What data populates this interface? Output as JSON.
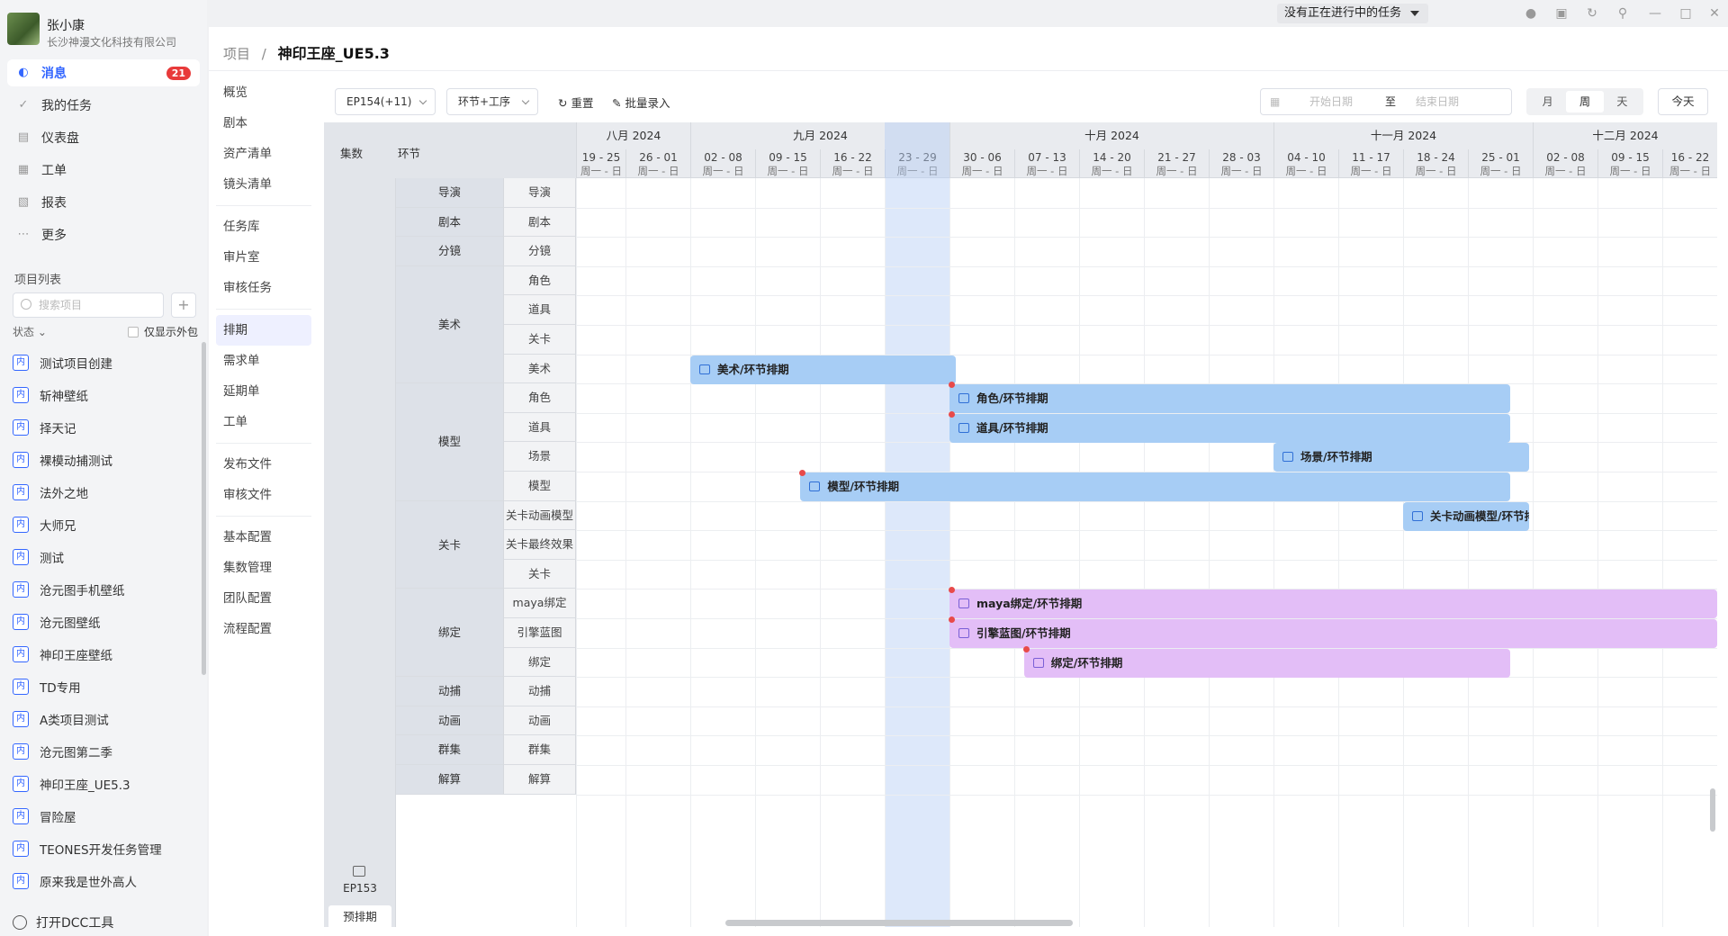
{
  "user": {
    "name": "张小康",
    "company": "长沙神漫文化科技有限公司"
  },
  "nav": [
    {
      "label": "消息",
      "icon": "message-icon",
      "badge": "21"
    },
    {
      "label": "我的任务",
      "icon": "check-icon"
    },
    {
      "label": "仪表盘",
      "icon": "dashboard-icon"
    },
    {
      "label": "工单",
      "icon": "workorder-icon"
    },
    {
      "label": "报表",
      "icon": "report-icon"
    },
    {
      "label": "更多",
      "icon": "more-icon"
    }
  ],
  "projects": {
    "heading": "项目列表",
    "search_placeholder": "搜索项目",
    "add": "+",
    "status_filter": "状态",
    "external_only": "仅显示外包",
    "tag": "内",
    "items": [
      "测试项目创建",
      "斩神壁纸",
      "择天记",
      "裸模动捕测试",
      "法外之地",
      "大师兄",
      "测试",
      "沧元图手机壁纸",
      "沧元图壁纸",
      "神印王座壁纸",
      "TD专用",
      "A类项目测试",
      "沧元图第二季",
      "神印王座_UE5.3",
      "冒险屋",
      "TEONES开发任务管理",
      "原来我是世外高人"
    ],
    "dcc": "打开DCC工具"
  },
  "titlebar": {
    "task_status": "没有正在进行中的任务"
  },
  "breadcrumb": {
    "root": "项目",
    "sep": "/",
    "current": "神印王座_UE5.3"
  },
  "subnav": {
    "groups": [
      [
        "概览",
        "剧本",
        "资产清单",
        "镜头清单"
      ],
      [
        "任务库",
        "审片室",
        "审核任务"
      ],
      [
        "排期",
        "需求单",
        "延期单",
        "工单"
      ],
      [
        "发布文件",
        "审核文件"
      ],
      [
        "基本配置",
        "集数管理",
        "团队配置",
        "流程配置"
      ]
    ],
    "active": "排期"
  },
  "toolbar": {
    "episode": "EP154(+11)",
    "mode": "环节+工序",
    "reset": "重置",
    "batch": "批量录入",
    "start_placeholder": "开始日期",
    "to": "至",
    "end_placeholder": "结束日期",
    "views": [
      "月",
      "周",
      "天"
    ],
    "active_view": "周",
    "today": "今天"
  },
  "schedule": {
    "head_episode": "集数",
    "head_stage": "环节",
    "episode": "EP153",
    "pre_btn": "预排期",
    "months": [
      {
        "label": "八月 2024",
        "weeks": 2
      },
      {
        "label": "九月 2024",
        "weeks": 4
      },
      {
        "label": "十月 2024",
        "weeks": 5
      },
      {
        "label": "十一月 2024",
        "weeks": 4
      },
      {
        "label": "十二月 2024",
        "weeks": 3
      }
    ],
    "weeks": [
      "19 - 25",
      "26 - 01",
      "02 - 08",
      "09 - 15",
      "16 - 22",
      "23 - 29",
      "30 - 06",
      "07 - 13",
      "14 - 20",
      "21 - 27",
      "28 - 03",
      "04 - 10",
      "11 - 17",
      "18 - 24",
      "25 - 01",
      "02 - 08",
      "09 - 15",
      "16 - 22"
    ],
    "week_sub": "周一 - 日",
    "highlight_week": 5,
    "stages": [
      {
        "name": "导演",
        "steps": [
          "导演"
        ]
      },
      {
        "name": "剧本",
        "steps": [
          "剧本"
        ]
      },
      {
        "name": "分镜",
        "steps": [
          "分镜"
        ]
      },
      {
        "name": "美术",
        "steps": [
          "角色",
          "道具",
          "关卡",
          "美术"
        ]
      },
      {
        "name": "模型",
        "steps": [
          "角色",
          "道具",
          "场景",
          "模型"
        ]
      },
      {
        "name": "关卡",
        "steps": [
          "关卡动画模型",
          "关卡最终效果",
          "关卡"
        ]
      },
      {
        "name": "绑定",
        "steps": [
          "maya绑定",
          "引擎蓝图",
          "绑定"
        ]
      },
      {
        "name": "动捕",
        "steps": [
          "动捕"
        ]
      },
      {
        "name": "动画",
        "steps": [
          "动画"
        ]
      },
      {
        "name": "群集",
        "steps": [
          "群集"
        ]
      },
      {
        "name": "解算",
        "steps": [
          "解算"
        ]
      }
    ],
    "bars": [
      {
        "label": "美术/环节排期",
        "row": 6,
        "start": 2.0,
        "end": 6.1,
        "color": "blue",
        "dot": false
      },
      {
        "label": "角色/环节排期",
        "row": 7,
        "start": 6.0,
        "end": 14.65,
        "color": "blue",
        "dot": true
      },
      {
        "label": "道具/环节排期",
        "row": 8,
        "start": 6.0,
        "end": 14.65,
        "color": "blue",
        "dot": true
      },
      {
        "label": "场景/环节排期",
        "row": 9,
        "start": 11.0,
        "end": 14.95,
        "color": "blue",
        "dot": false
      },
      {
        "label": "模型/环节排期",
        "row": 10,
        "start": 3.7,
        "end": 14.65,
        "color": "blue",
        "dot": true
      },
      {
        "label": "关卡动画模型/环节排期",
        "row": 11,
        "start": 13.0,
        "end": 14.95,
        "color": "blue",
        "dot": false
      },
      {
        "label": "maya绑定/环节排期",
        "row": 14,
        "start": 6.0,
        "end": 18.0,
        "color": "purple",
        "dot": true
      },
      {
        "label": "引擎蓝图/环节排期",
        "row": 15,
        "start": 6.0,
        "end": 18.0,
        "color": "purple",
        "dot": true
      },
      {
        "label": "绑定/环节排期",
        "row": 16,
        "start": 7.15,
        "end": 14.65,
        "color": "purple",
        "dot": true
      }
    ]
  }
}
